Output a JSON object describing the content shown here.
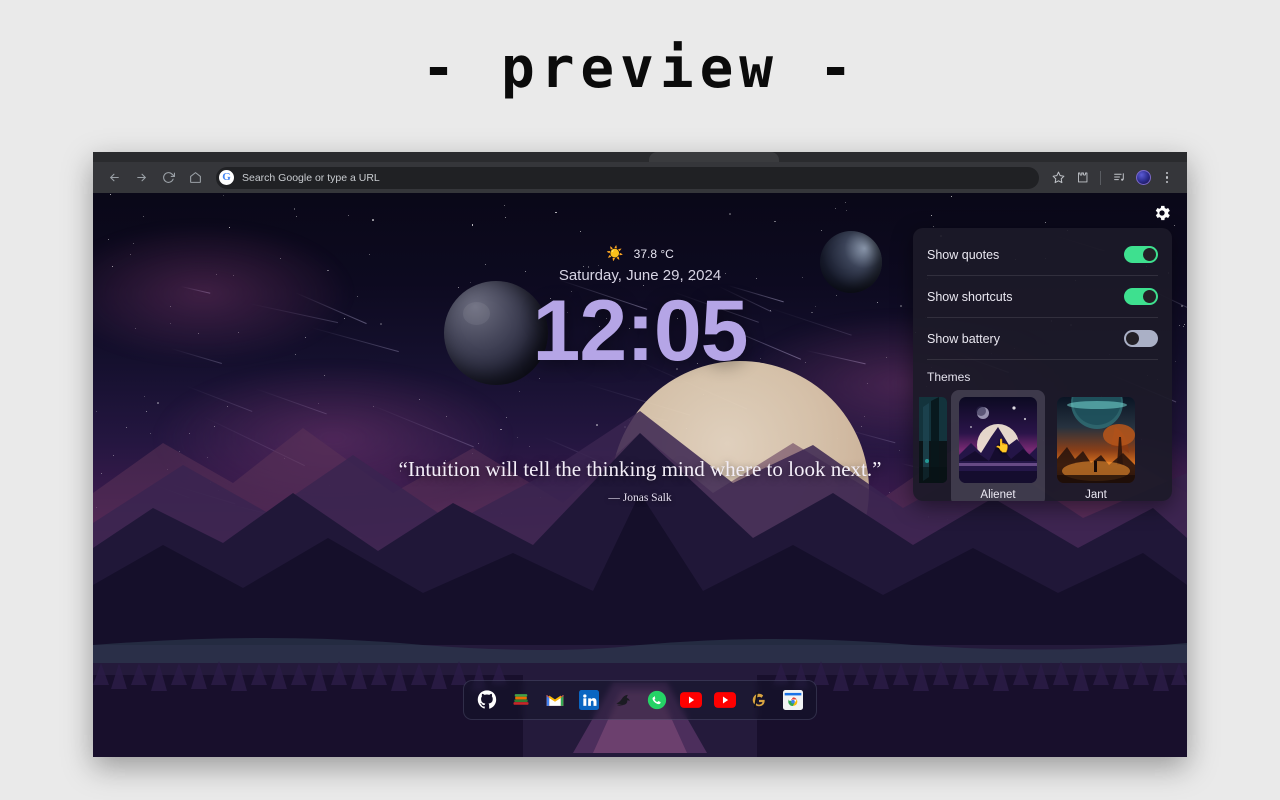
{
  "page": {
    "title": "-  preview  -"
  },
  "browser": {
    "nav": {
      "back": "back-arrow",
      "forward": "forward-arrow",
      "reload": "reload",
      "home": "home"
    },
    "omnibox": {
      "search_engine_badge": "G",
      "placeholder": "Search Google or type a URL",
      "value": ""
    },
    "toolbar_right": {
      "bookmark": "star-icon",
      "extensions": "puzzle-icon",
      "side_panel": "side-panel-icon",
      "profile": "avatar",
      "menu": "three-dot-menu"
    }
  },
  "newtab": {
    "weather": {
      "icon": "sun-icon",
      "temperature": "37.8 °C"
    },
    "date": "Saturday, June 29, 2024",
    "clock": "12:05",
    "quote": {
      "text": "“Intuition will tell the thinking mind where to look next.”",
      "author": "— Jonas Salk"
    },
    "shortcuts": [
      {
        "name": "github",
        "label": "GitHub"
      },
      {
        "name": "books",
        "label": "Books"
      },
      {
        "name": "gmail",
        "label": "Gmail"
      },
      {
        "name": "linkedin",
        "label": "LinkedIn"
      },
      {
        "name": "dark-bird",
        "label": "Bird"
      },
      {
        "name": "whatsapp",
        "label": "WhatsApp"
      },
      {
        "name": "youtube-1",
        "label": "YouTube"
      },
      {
        "name": "youtube-2",
        "label": "YouTube"
      },
      {
        "name": "gold-g",
        "label": "G"
      },
      {
        "name": "chrome-webstore",
        "label": "Chrome Web Store"
      }
    ]
  },
  "settings": {
    "gear": "gear-icon",
    "rows": [
      {
        "label": "Show quotes",
        "state": "on"
      },
      {
        "label": "Show shortcuts",
        "state": "on"
      },
      {
        "label": "Show battery",
        "state": "off"
      }
    ],
    "themes_title": "Themes",
    "themes": [
      {
        "name": "",
        "selected": false,
        "clipped": true
      },
      {
        "name": "Alienet",
        "selected": true,
        "clipped": false
      },
      {
        "name": "Jant",
        "selected": false,
        "clipped": false
      }
    ]
  },
  "colors": {
    "toggle_on": "#3ee08f",
    "toggle_off": "#aab0c6",
    "clock": "#b5a5e6",
    "panel_bg": "#1c1a28",
    "page_bg": "#eaeaea",
    "browser_chrome": "#35363a"
  }
}
